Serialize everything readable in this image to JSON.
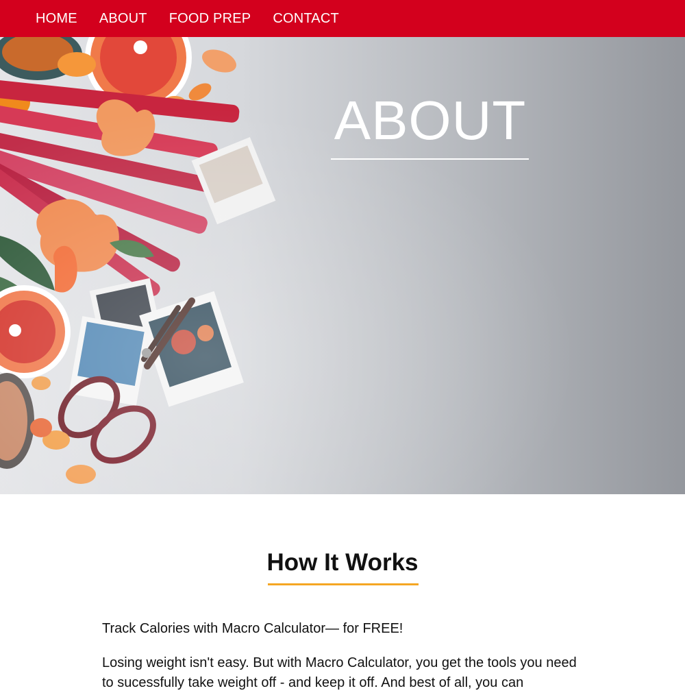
{
  "nav": {
    "items": [
      {
        "label": "HOME"
      },
      {
        "label": "ABOUT"
      },
      {
        "label": "FOOD PREP"
      },
      {
        "label": "CONTACT"
      }
    ],
    "background_color": "#d3001d"
  },
  "hero": {
    "title": "ABOUT"
  },
  "section": {
    "title": "How It Works",
    "accent_color": "#f5a623",
    "paragraphs": [
      "Track Calories with Macro Calculator— for FREE!",
      "Losing weight isn't easy. But with Macro Calculator, you get the tools you need to sucessfully take weight off - and keep it off. And best of all, you can"
    ]
  }
}
